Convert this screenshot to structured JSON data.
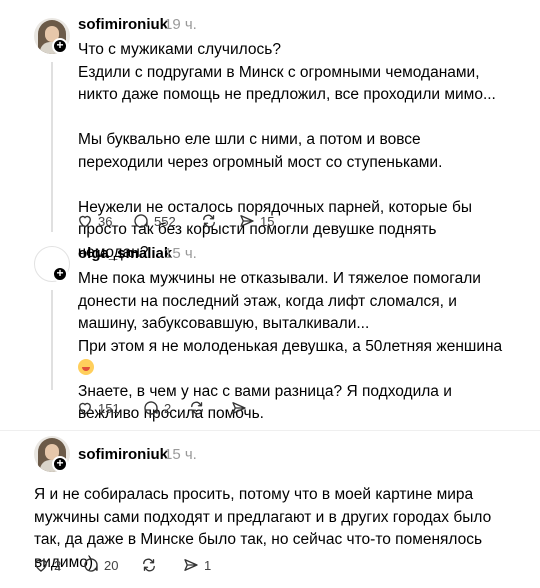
{
  "posts": [
    {
      "username": "sofimironiuk",
      "time": "19 ч.",
      "text": "Что с мужиками случилось?\nЕздили с подругами в Минск с огромными чемоданами, никто даже помощь не предложил, все проходили мимо...\n\nМы буквально еле шли с ними, а потом и вовсе переходили через огромный мост со ступеньками.\n\nНеужели не осталось порядочных парней, которые бы просто так без корысти помогли девушке поднять чемодан?",
      "likes": "36",
      "comments": "552",
      "reposts": "",
      "shares": "15"
    },
    {
      "username": "olga_smaliak",
      "time": "15 ч.",
      "text": "Мне пока мужчины не отказывали. И тяжелое помогали донести на последний этаж, когда лифт сломался, и машину, забуксовавшую, выталкивали...\nПри этом я не молоденькая девушка, а 50летняя женшина",
      "text2": "Знаете, в чем у нас с вами разница? Я подходила и вежливо просила помочь.",
      "likes": "151",
      "comments": "2",
      "reposts": "",
      "shares": ""
    },
    {
      "username": "sofimironiuk",
      "time": "15 ч.",
      "text": "Я и не собиралась просить, потому что в моей картине мира мужчины сами подходят и предлагают и в других городах было так, да даже в Минске было так, но сейчас что-то поменялось видимо)",
      "likes": "2",
      "comments": "20",
      "reposts": "",
      "shares": "1"
    }
  ],
  "icons": {
    "like": "heart-icon",
    "comment": "comment-icon",
    "repost": "repost-icon",
    "share": "send-icon"
  }
}
